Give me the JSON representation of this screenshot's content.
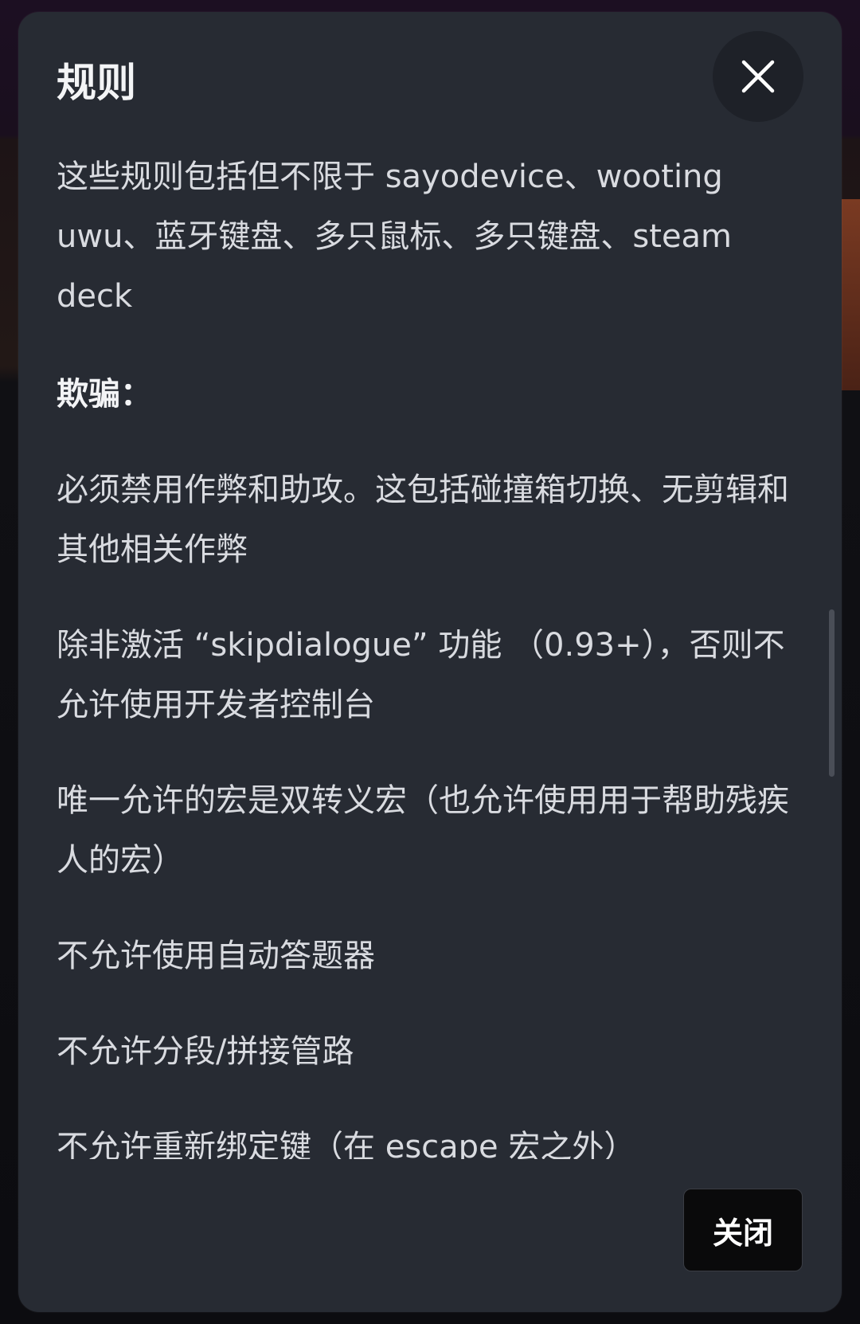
{
  "modal": {
    "title": "规则",
    "intro": "这些规则包括但不限于 sayodevice、wooting uwu、蓝牙键盘、多只鼠标、多只键盘、steam deck",
    "section_heading": "欺骗：",
    "rules": [
      "必须禁用作弊和助攻。这包括碰撞箱切换、无剪辑和其他相关作弊",
      "除非激活 “skipdialogue” 功能 （0.93+），否则不允许使用开发者控制台",
      "唯一允许的宏是双转义宏（也允许使用用于帮助残疾人的宏）",
      "不允许使用自动答题器",
      "不允许分段/拼接管路",
      "不允许重新绑定键（在 escape 宏之外）"
    ],
    "close_button_label": "关闭"
  },
  "icons": {
    "close": "close-icon"
  },
  "colors": {
    "modal_bg": "#272b33",
    "close_circle_bg": "#1e2128",
    "text": "#d9dbe0",
    "button_bg": "#0a0a0b"
  }
}
